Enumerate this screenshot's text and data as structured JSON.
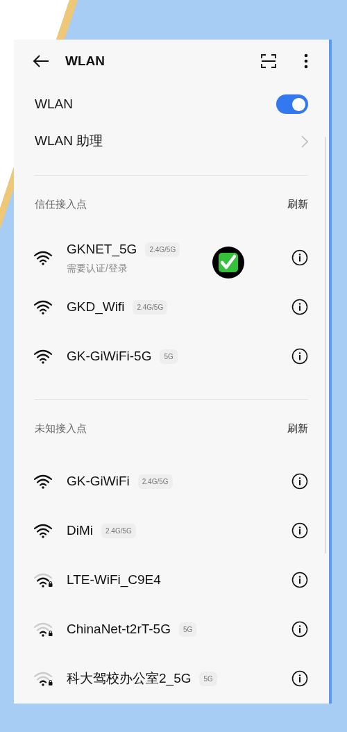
{
  "header": {
    "title": "WLAN"
  },
  "wlan": {
    "label": "WLAN",
    "on": true
  },
  "assistant": {
    "label": "WLAN 助理"
  },
  "sections": [
    {
      "title": "信任接入点",
      "action": "刷新",
      "networks": [
        {
          "kind": "open",
          "name": "GKNET_5G",
          "band": "2.4G/5G",
          "status": "需要认证/登录",
          "marked": true
        },
        {
          "kind": "open",
          "name": "GKD_Wifi",
          "band": "2.4G/5G",
          "marked": false
        },
        {
          "kind": "open",
          "name": "GK-GiWiFi-5G",
          "band": "5G",
          "marked": false
        }
      ]
    },
    {
      "title": "未知接入点",
      "action": "刷新",
      "networks": [
        {
          "kind": "open",
          "name": "GK-GiWiFi",
          "band": "2.4G/5G",
          "marked": false
        },
        {
          "kind": "open",
          "name": "DiMi",
          "band": "2.4G/5G",
          "marked": false
        },
        {
          "kind": "locked",
          "name": "LTE-WiFi_C9E4",
          "marked": false
        },
        {
          "kind": "locked_weak",
          "name": "ChinaNet-t2rT-5G",
          "band": "5G",
          "marked": false
        },
        {
          "kind": "locked_weak",
          "name": "科大驾校办公室2_5G",
          "band": "5G",
          "marked": false
        }
      ]
    }
  ]
}
